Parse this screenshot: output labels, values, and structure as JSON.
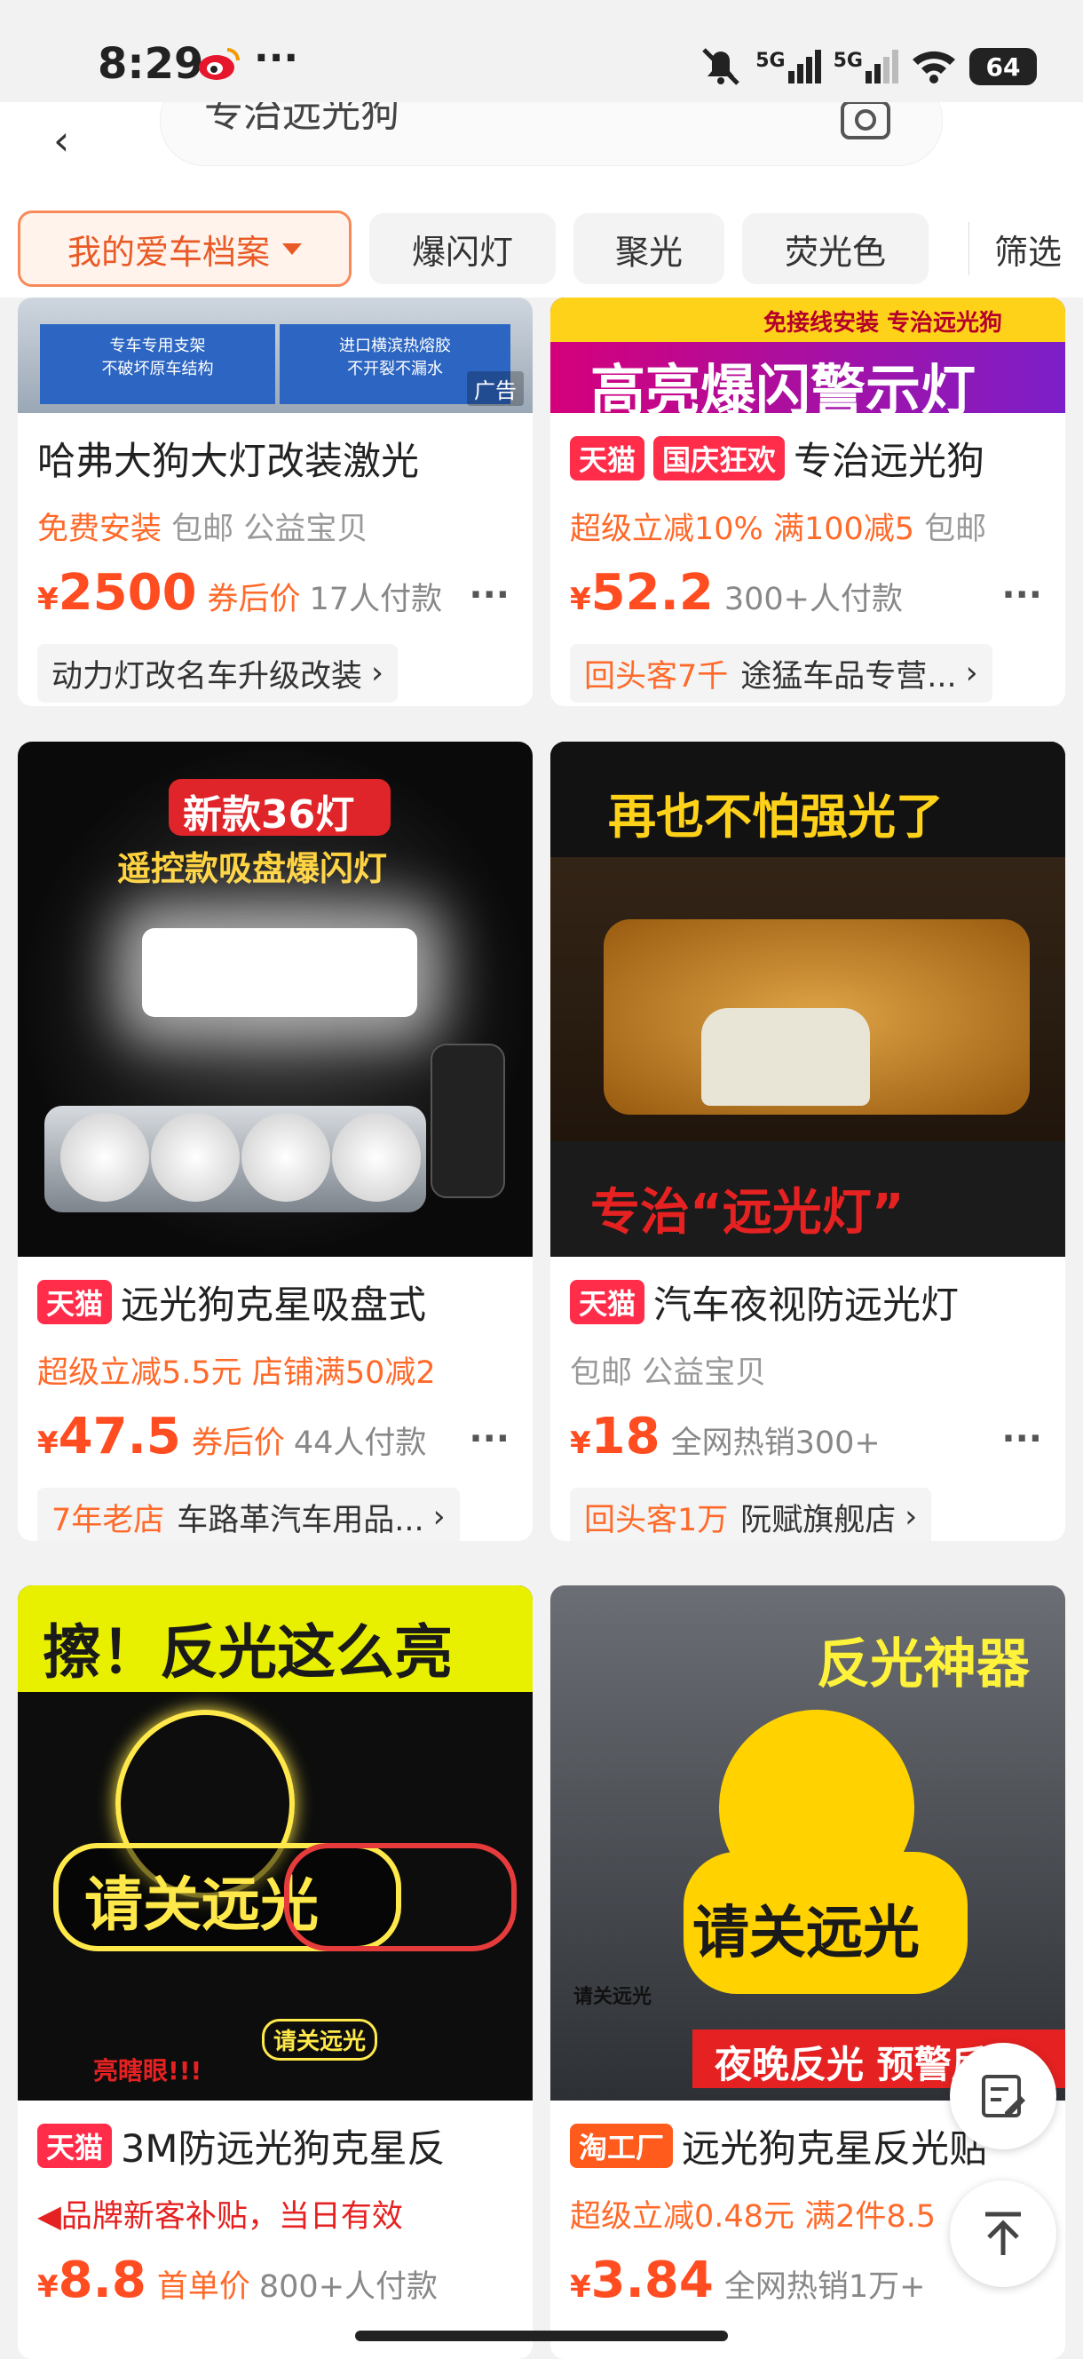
{
  "status_bar": {
    "time": "8:29",
    "more": "···",
    "network1": "5G",
    "network2": "5G",
    "battery": "64"
  },
  "search": {
    "query": "专治远光狗"
  },
  "filters": {
    "items": [
      "我的爱车档案",
      "爆闪灯",
      "聚光",
      "荧光色"
    ],
    "screen": "筛选"
  },
  "products": [
    {
      "image_text": {
        "left": "专车专用支架\n不破坏原车结构",
        "right": "进口横滨热熔胶\n不开裂不漏水"
      },
      "ad_badge": "广告",
      "title": "哈弗大狗大灯改装激光",
      "line2": [
        "免费安装",
        "包邮",
        "公益宝贝"
      ],
      "yen": "¥",
      "price": "2500",
      "after_label": "券后价",
      "sold": "17人付款",
      "shop": "动力灯改名车升级改装",
      "shop_prefix": "",
      "more": "···"
    },
    {
      "image_text": {
        "top": "免接线安装 专治远光狗",
        "main": "高亮爆闪警示灯"
      },
      "tags": [
        "天猫",
        "国庆狂欢"
      ],
      "title": "专治远光狗",
      "line2": [
        "超级立减10%",
        "满100减5",
        "包邮"
      ],
      "yen": "¥",
      "price": "52.2",
      "after_label": "",
      "sold": "300+人付款",
      "shop_prefix": "回头客7千",
      "shop": "途猛车品专营...",
      "more": "···"
    },
    {
      "image_text": {
        "badge": "新款36灯",
        "sub": "遥控款吸盘爆闪灯"
      },
      "tags": [
        "天猫"
      ],
      "title": "远光狗克星吸盘式",
      "line2": [
        "超级立减5.5元",
        "店铺满50减2"
      ],
      "yen": "¥",
      "price": "47.5",
      "after_label": "券后价",
      "sold": "44人付款",
      "shop_prefix": "7年老店",
      "shop": "车路革汽车用品...",
      "more": "···"
    },
    {
      "image_text": {
        "top": "再也不怕强光了",
        "bottom": "专治“远光灯”"
      },
      "tags": [
        "天猫"
      ],
      "title": "汽车夜视防远光灯",
      "line2": [
        "包邮",
        "公益宝贝"
      ],
      "yen": "¥",
      "price": "18",
      "after_label": "",
      "sold": "全网热销300+",
      "shop_prefix": "回头客1万",
      "shop": "阮赋旗舰店",
      "more": "···"
    },
    {
      "image_text": {
        "top": "擦！反光这么亮",
        "sign": "请关远光",
        "small": "请关远光",
        "dog": "亮瞎眼!!!"
      },
      "tags": [
        "天猫"
      ],
      "title": "3M防远光狗克星反",
      "line2": [
        "品牌新客补贴，当日有效"
      ],
      "yen": "¥",
      "price": "8.8",
      "after_label": "首单价",
      "sold": "800+人付款"
    },
    {
      "image_text": {
        "top": "反光神器",
        "sign": "请关远光",
        "small": "请关远光",
        "bottom": "夜晚反光 预警后方"
      },
      "tags": [
        "淘工厂"
      ],
      "title": "远光狗克星反光贴",
      "line2": [
        "超级立减0.48元",
        "满2件8.5"
      ],
      "yen": "¥",
      "price": "3.84",
      "after_label": "",
      "sold": "全网热销1万+"
    }
  ]
}
